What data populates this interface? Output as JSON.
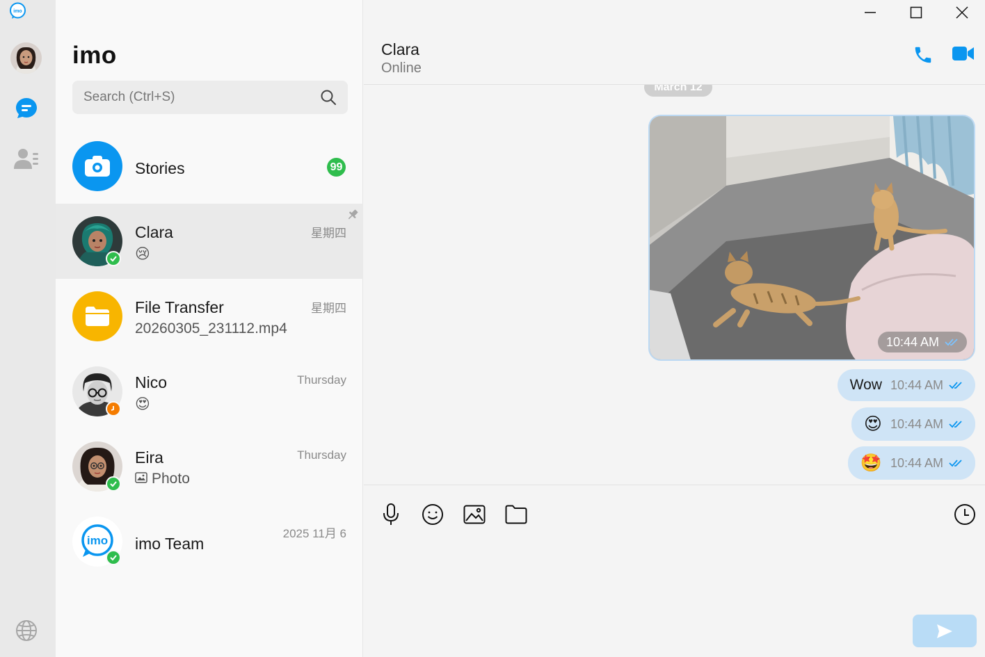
{
  "app": {
    "title": "imo"
  },
  "colors": {
    "accent": "#0a96f0",
    "online": "#2fbd4d",
    "away": "#f57c00",
    "bubble": "#cfe4f6"
  },
  "rail": {
    "icons": [
      "imo-logo-icon",
      "chat-icon",
      "contacts-icon",
      "globe-icon"
    ]
  },
  "search": {
    "placeholder": "Search (Ctrl+S)"
  },
  "stories": {
    "label": "Stories",
    "count": "99"
  },
  "chats": [
    {
      "name": "Clara",
      "preview": "😢",
      "time": "星期四",
      "pinned": true,
      "status": "online",
      "active": true
    },
    {
      "name": "File Transfer",
      "preview": "20260305_231112.mp4",
      "time": "星期四"
    },
    {
      "name": "Nico",
      "preview": "😍",
      "time": "Thursday",
      "status": "away"
    },
    {
      "name": "Eira",
      "preview": "Photo",
      "time": "Thursday",
      "status": "online"
    },
    {
      "name": "imo Team",
      "preview": "",
      "time": "2025 11月 6",
      "status": "online"
    }
  ],
  "conversation": {
    "contact": "Clara",
    "status": "Online",
    "date_divider": "March 12",
    "messages": [
      {
        "type": "photo",
        "time": "10:44 AM",
        "read": true
      },
      {
        "type": "text",
        "text": "Wow",
        "time": "10:44 AM",
        "read": true
      },
      {
        "type": "emoji",
        "text": "😍",
        "time": "10:44 AM",
        "read": true
      },
      {
        "type": "emoji",
        "text": "🤩",
        "time": "10:44 AM",
        "read": true
      }
    ]
  }
}
